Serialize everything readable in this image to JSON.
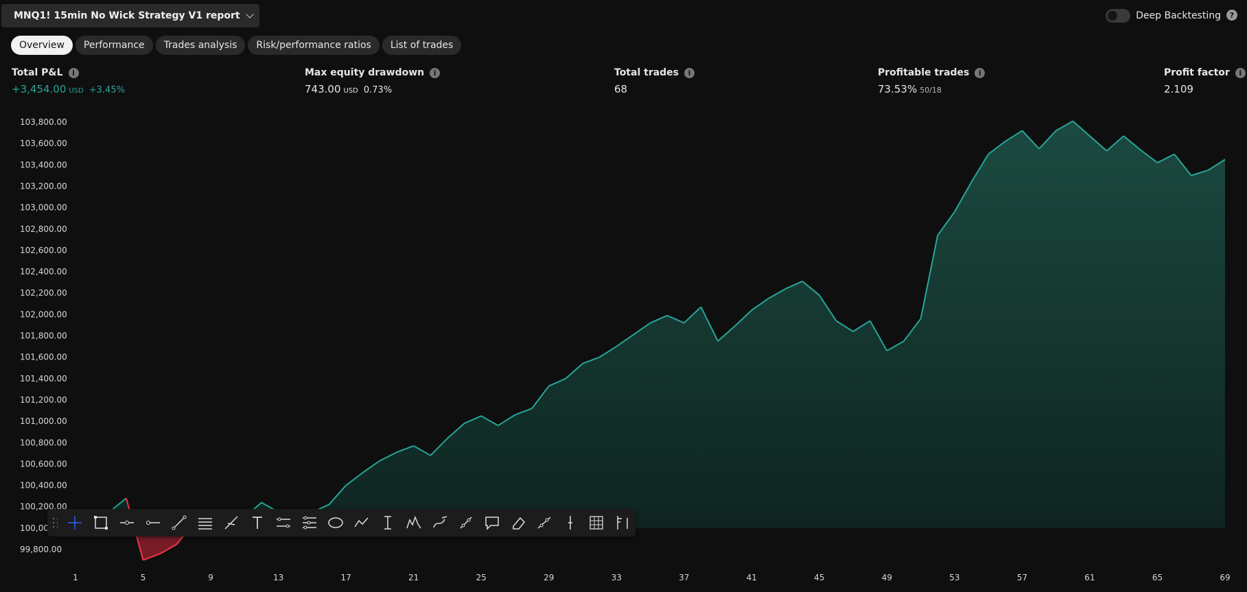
{
  "header": {
    "report_title": "MNQ1! 15min No Wick Strategy V1 report",
    "deep_backtesting_label": "Deep Backtesting",
    "deep_backtesting_enabled": false,
    "help_glyph": "?"
  },
  "tabs": [
    {
      "label": "Overview",
      "active": true
    },
    {
      "label": "Performance",
      "active": false
    },
    {
      "label": "Trades analysis",
      "active": false
    },
    {
      "label": "Risk/performance ratios",
      "active": false
    },
    {
      "label": "List of trades",
      "active": false
    }
  ],
  "metrics": {
    "total_pnl": {
      "label": "Total P&L",
      "value": "+3,454.00",
      "unit": "USD",
      "percent": "+3.45%"
    },
    "max_drawdown": {
      "label": "Max equity drawdown",
      "value": "743.00",
      "unit": "USD",
      "percent": "0.73%"
    },
    "total_trades": {
      "label": "Total trades",
      "value": "68"
    },
    "profitable_trades": {
      "label": "Profitable trades",
      "value": "73.53%",
      "ratio": "50/18"
    },
    "profit_factor": {
      "label": "Profit factor",
      "value": "2.109"
    }
  },
  "colors": {
    "positive": "#26a69a",
    "negative": "#f23645",
    "positive_fill_top": "#1b4a40",
    "positive_fill_bottom": "#0f2420",
    "negative_fill": "#8a1f2b"
  },
  "chart_data": {
    "type": "area",
    "title": "",
    "xlabel": "",
    "ylabel": "",
    "baseline": 100000,
    "ylim": [
      99700,
      103900
    ],
    "y_ticks": [
      "103,800.00",
      "103,600.00",
      "103,400.00",
      "103,200.00",
      "103,000.00",
      "102,800.00",
      "102,600.00",
      "102,400.00",
      "102,200.00",
      "102,000.00",
      "101,800.00",
      "101,600.00",
      "101,400.00",
      "101,200.00",
      "101,000.00",
      "100,800.00",
      "100,600.00",
      "100,400.00",
      "100,200.00",
      "100,000.00",
      "99,800.00"
    ],
    "y_tick_values": [
      103800,
      103600,
      103400,
      103200,
      103000,
      102800,
      102600,
      102400,
      102200,
      102000,
      101800,
      101600,
      101400,
      101200,
      101000,
      100800,
      100600,
      100400,
      100200,
      100000,
      99800
    ],
    "x_ticks": [
      1,
      5,
      9,
      13,
      17,
      21,
      25,
      29,
      33,
      37,
      41,
      45,
      49,
      53,
      57,
      61,
      65,
      69
    ],
    "x": [
      1,
      2,
      3,
      4,
      5,
      6,
      7,
      8,
      9,
      10,
      11,
      12,
      13,
      14,
      15,
      16,
      17,
      18,
      19,
      20,
      21,
      22,
      23,
      24,
      25,
      26,
      27,
      28,
      29,
      30,
      31,
      32,
      33,
      34,
      35,
      36,
      37,
      38,
      39,
      40,
      41,
      42,
      43,
      44,
      45,
      46,
      47,
      48,
      49,
      50,
      51,
      52,
      53,
      54,
      55,
      56,
      57,
      58,
      59,
      60,
      61,
      62,
      63,
      64,
      65,
      66,
      67,
      68,
      69
    ],
    "equity": [
      100000,
      100000,
      100150,
      100280,
      99700,
      99760,
      99850,
      100050,
      100150,
      100100,
      100100,
      100240,
      100150,
      100100,
      100150,
      100220,
      100400,
      100520,
      100630,
      100710,
      100770,
      100680,
      100840,
      100980,
      101050,
      100960,
      101060,
      101120,
      101330,
      101400,
      101540,
      101600,
      101700,
      101810,
      101920,
      101990,
      101920,
      102070,
      101750,
      101890,
      102040,
      102150,
      102240,
      102310,
      102180,
      101940,
      101840,
      101940,
      101660,
      101750,
      101960,
      102740,
      102960,
      103240,
      103500,
      103620,
      103720,
      103550,
      103720,
      103810,
      103670,
      103530,
      103670,
      103540,
      103420,
      103500,
      103300,
      103350,
      103450
    ]
  },
  "toolbar": {
    "tools": [
      "crosshair-icon",
      "rectangle-select-icon",
      "horizontal-ray-icon",
      "horizontal-line-icon",
      "trend-line-icon",
      "parallel-lines-icon",
      "arrow-line-icon",
      "text-icon",
      "info-line-icon",
      "long-position-icon",
      "ellipse-icon",
      "polyline-icon",
      "price-range-icon",
      "pattern-icon",
      "brush-icon",
      "measure-icon",
      "callout-icon",
      "eraser-icon",
      "anchored-line-icon",
      "vertical-line-icon",
      "grid-icon",
      "flag-measure-icon"
    ]
  }
}
